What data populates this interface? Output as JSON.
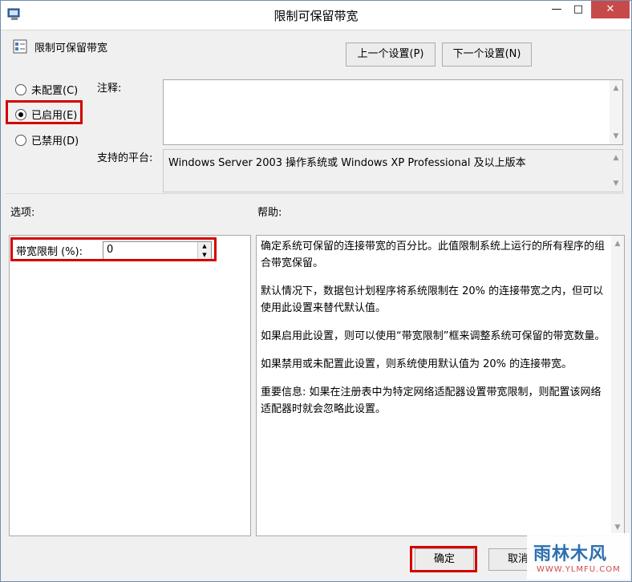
{
  "window": {
    "title": "限制可保留带宽",
    "minimize_glyph": "—",
    "maximize_glyph": "□",
    "close_glyph": "✕"
  },
  "header": {
    "setting_title": "限制可保留带宽",
    "prev_button": "上一个设置(P)",
    "next_button": "下一个设置(N)"
  },
  "state": {
    "options": [
      {
        "label": "未配置(C)",
        "selected": false
      },
      {
        "label": "已启用(E)",
        "selected": true
      },
      {
        "label": "已禁用(D)",
        "selected": false
      }
    ]
  },
  "comment": {
    "label": "注释:",
    "value": ""
  },
  "platform": {
    "label": "支持的平台:",
    "value": "Windows Server 2003 操作系统或 Windows XP Professional 及以上版本"
  },
  "options_panel": {
    "label": "选项:",
    "bandwidth_label": "带宽限制 (%):",
    "bandwidth_value": "0"
  },
  "help_panel": {
    "label": "帮助:",
    "paragraphs": [
      "确定系统可保留的连接带宽的百分比。此值限制系统上运行的所有程序的组合带宽保留。",
      "默认情况下，数据包计划程序将系统限制在 20% 的连接带宽之内，但可以使用此设置来替代默认值。",
      "如果启用此设置，则可以使用“带宽限制”框来调整系统可保留的带宽数量。",
      "如果禁用或未配置此设置，则系统使用默认值为 20% 的连接带宽。",
      "重要信息: 如果在注册表中为特定网络适配器设置带宽限制，则配置该网络适配器时就会忽略此设置。"
    ]
  },
  "footer": {
    "ok_button": "确定",
    "cancel_button": "取消"
  },
  "watermark": {
    "main": "雨林木风",
    "sub": "WWW.YLMFU.COM"
  },
  "colors": {
    "highlight": "#d40000",
    "close_button": "#c74a4a",
    "watermark_blue": "#2d6fb0"
  }
}
